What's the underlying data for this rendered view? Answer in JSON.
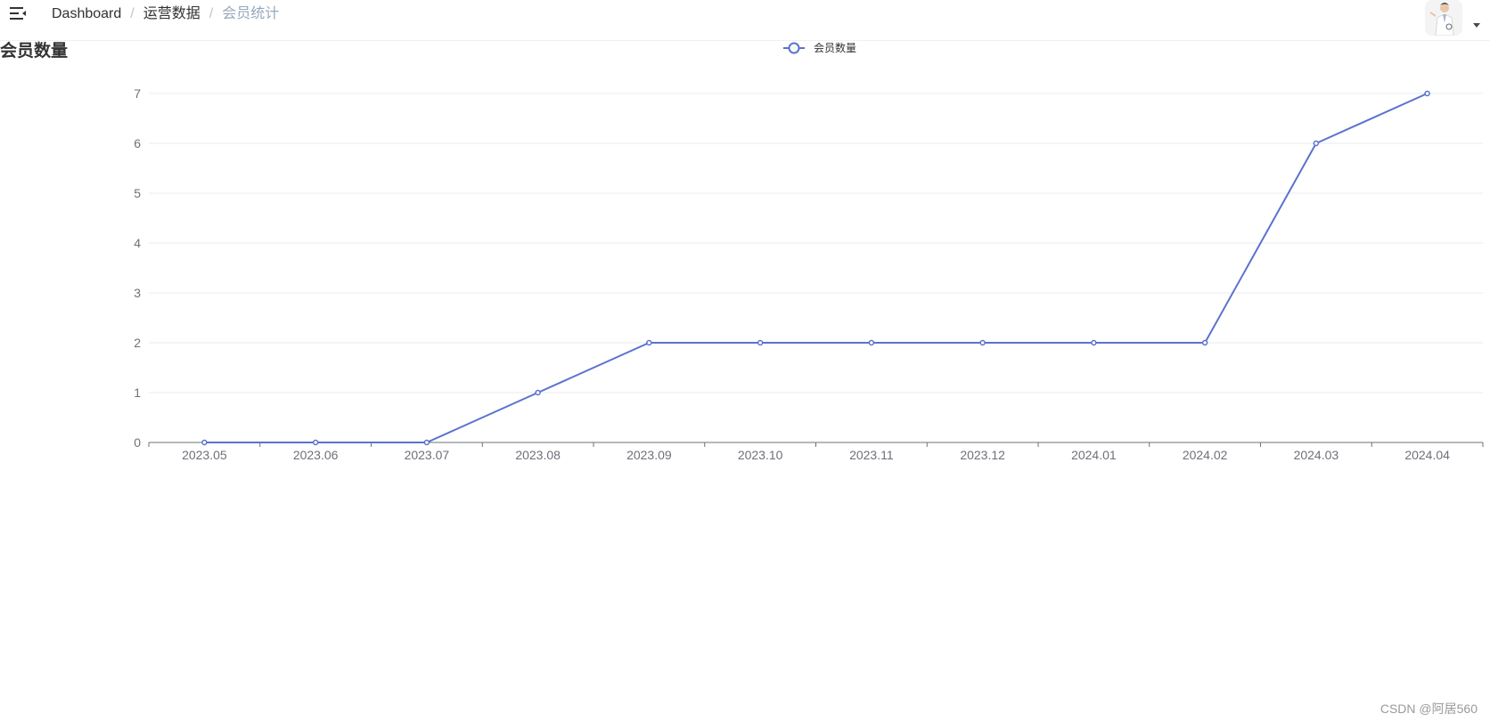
{
  "navbar": {
    "menu_icon": "hamburger-fold-icon",
    "breadcrumb": {
      "items": [
        "Dashboard",
        "运营数据",
        "会员统计"
      ],
      "separator": "/"
    },
    "avatar_icon": "user-avatar-image",
    "dropdown_icon": "caret-down-icon"
  },
  "page": {
    "title": "会员数量"
  },
  "colors": {
    "line": "#5b72cd",
    "grid": "#e8ebf3",
    "axis": "#6e7079"
  },
  "chart_data": {
    "type": "line",
    "legend_position": "top-center",
    "grid": true,
    "categories": [
      "2023.05",
      "2023.06",
      "2023.07",
      "2023.08",
      "2023.09",
      "2023.10",
      "2023.11",
      "2023.12",
      "2024.01",
      "2024.02",
      "2024.03",
      "2024.04"
    ],
    "series": [
      {
        "name": "会员数量",
        "values": [
          0,
          0,
          0,
          1,
          2,
          2,
          2,
          2,
          2,
          2,
          6,
          7
        ]
      }
    ],
    "ylim": [
      0,
      7
    ],
    "yticks": [
      0,
      1,
      2,
      3,
      4,
      5,
      6,
      7
    ]
  },
  "watermark": "CSDN @阿居560"
}
